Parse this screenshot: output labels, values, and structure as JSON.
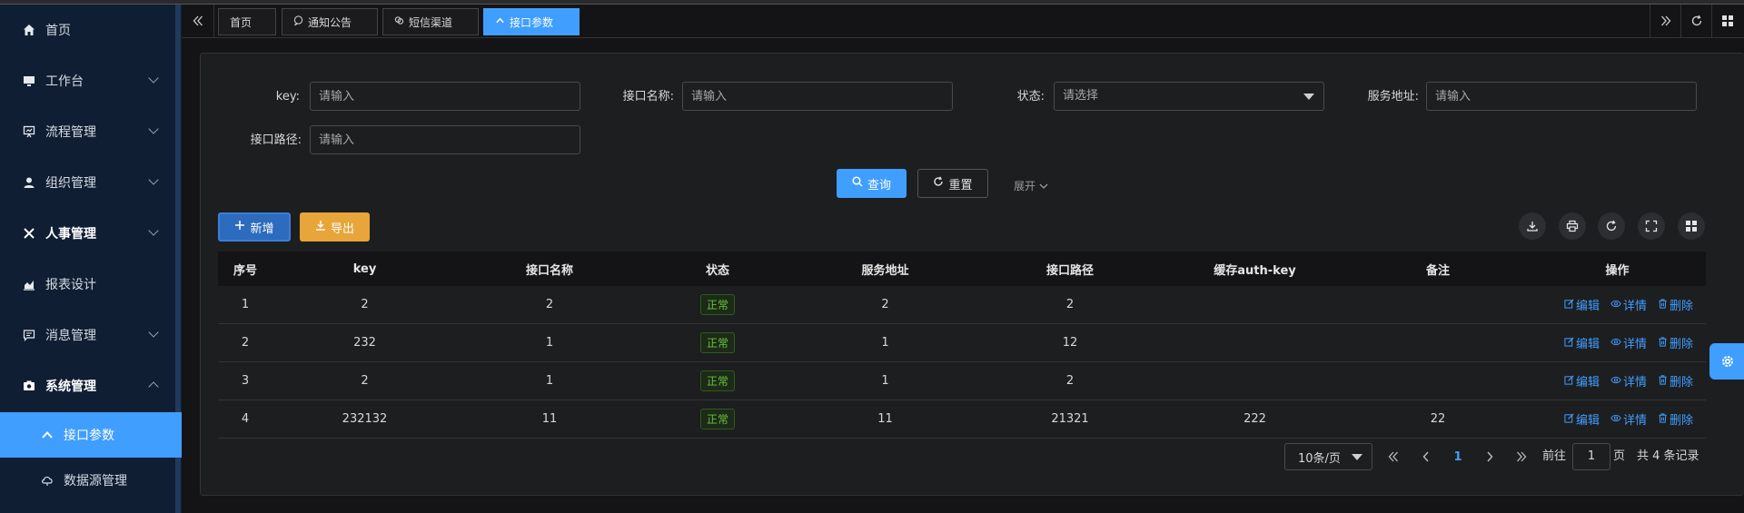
{
  "sidebar": {
    "items": [
      {
        "label": "首页",
        "icon": "home-icon"
      },
      {
        "label": "工作台",
        "icon": "monitor-icon"
      },
      {
        "label": "流程管理",
        "icon": "flow-icon"
      },
      {
        "label": "组织管理",
        "icon": "user-icon"
      },
      {
        "label": "人事管理",
        "icon": "close-icon"
      },
      {
        "label": "报表设计",
        "icon": "chart-icon"
      },
      {
        "label": "消息管理",
        "icon": "message-icon"
      },
      {
        "label": "系统管理",
        "icon": "camera-icon"
      }
    ],
    "sub_items": [
      {
        "label": "接口参数",
        "icon": "chevron-up-icon"
      },
      {
        "label": "数据源管理",
        "icon": "cloud-icon"
      }
    ]
  },
  "tabs": [
    {
      "label": "首页",
      "icon": ""
    },
    {
      "label": "通知公告",
      "icon": "chat-icon"
    },
    {
      "label": "短信渠道",
      "icon": "link-icon"
    },
    {
      "label": "接口参数",
      "icon": "chevron-up-icon"
    }
  ],
  "search": {
    "key_label": "key:",
    "key_placeholder": "请输入",
    "name_label": "接口名称:",
    "name_placeholder": "请输入",
    "status_label": "状态:",
    "status_placeholder": "请选择",
    "server_label": "服务地址:",
    "server_placeholder": "请输入",
    "path_label": "接口路径:",
    "path_placeholder": "请输入",
    "query_btn": "查询",
    "reset_btn": "重置",
    "expand": "展开"
  },
  "toolbar": {
    "add_btn": "新增",
    "export_btn": "导出"
  },
  "table": {
    "columns": [
      "序号",
      "key",
      "接口名称",
      "状态",
      "服务地址",
      "接口路径",
      "缓存auth-key",
      "备注",
      "操作"
    ],
    "rows": [
      {
        "idx": "1",
        "key": "2",
        "name": "2",
        "status": "正常",
        "server": "2",
        "path": "2",
        "auth": "",
        "remark": ""
      },
      {
        "idx": "2",
        "key": "232",
        "name": "1",
        "status": "正常",
        "server": "1",
        "path": "12",
        "auth": "",
        "remark": ""
      },
      {
        "idx": "3",
        "key": "2",
        "name": "1",
        "status": "正常",
        "server": "1",
        "path": "2",
        "auth": "",
        "remark": ""
      },
      {
        "idx": "4",
        "key": "232132",
        "name": "11",
        "status": "正常",
        "server": "11",
        "path": "21321",
        "auth": "222",
        "remark": "22"
      }
    ],
    "ops": {
      "edit": "编辑",
      "detail": "详情",
      "delete": "删除"
    }
  },
  "pagination": {
    "page_size": "10条/页",
    "current": "1",
    "goto_label": "前往",
    "goto_value": "1",
    "page_unit": "页",
    "total": "共 4 条记录"
  },
  "colors": {
    "accent": "#409eff",
    "success": "#67c23a",
    "export": "#e8a53a"
  }
}
